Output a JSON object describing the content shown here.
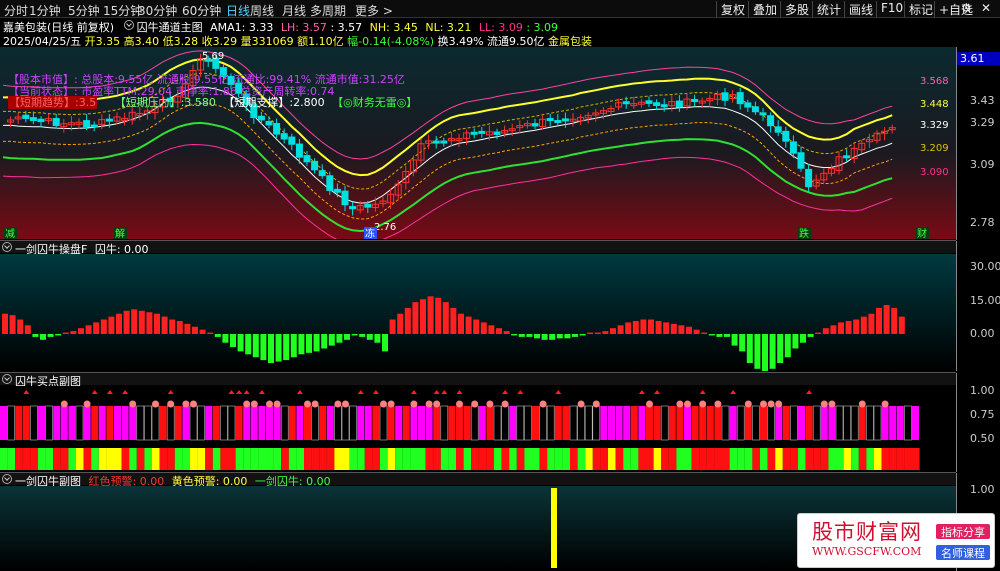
{
  "toolbar": {
    "periods": [
      "分时",
      "1分钟",
      "5分钟",
      "15分钟",
      "30分钟",
      "60分钟",
      "日线",
      "周线",
      "月线",
      "多周期",
      "更多 >"
    ],
    "active_period": "日线",
    "right_buttons": [
      "复权",
      "叠加",
      "多股",
      "统计",
      "画线",
      "F10",
      "标记",
      "+自选"
    ]
  },
  "stock": {
    "title": "嘉美包装(日线 前复权)",
    "indicator": "囚牛通道主图",
    "ama1": "AMA1: 3.33",
    "lh": "LH: 3.57",
    "h2": ": 3.57",
    "nh": "NH: 3.45",
    "nl": "NL: 3.21",
    "ll": "LL: 3.09",
    "l2": ": 3.09",
    "date": "2025/04/25/五",
    "open": "开3.35",
    "high": "高3.40",
    "low": "低3.28",
    "close": "收3.29",
    "vol": "量331069",
    "amount": "额1.10亿",
    "change": "幅-0.14(-4.08%)",
    "turnover": "换3.49%",
    "float_value": "流通9.50亿",
    "sector": "金属包装"
  },
  "overlay": {
    "line1": "【股本市值】: 总股本:9.55亿 流通股:9.55亿 流通比:99.41% 流通市值:31.25亿",
    "line2": "【当前状态】: 市盈率TTM:29.04 市净率:1.86 总资产周转率:0.74",
    "support_label": "【短期压力】:3.580",
    "press_label": "【短期支撑】:2.800",
    "finance_label": "【◎财务无雷◎】",
    "left_label": "【短期趋势】:3.5"
  },
  "main_chart": {
    "price_labels": [
      {
        "text": "5.69",
        "color": "#ffffff"
      },
      {
        "text": "2.76",
        "color": "#ffffff"
      }
    ],
    "right_values": [
      {
        "text": "3.568",
        "color": "#ff60b0"
      },
      {
        "text": "3.448",
        "color": "#ffff40"
      },
      {
        "text": "3.329",
        "color": "#ffffff"
      },
      {
        "text": "3.209",
        "color": "#e0c000"
      },
      {
        "text": "3.090",
        "color": "#ff3090"
      }
    ],
    "axis_ticks": [
      "3.61",
      "3.43",
      "3.29",
      "3.09",
      "2.78"
    ],
    "bottom_marks": [
      {
        "text": "减",
        "color": "#40ff40"
      },
      {
        "text": "解",
        "color": "#40ff40"
      },
      {
        "text": "冻",
        "color": "#ffffff"
      },
      {
        "text": "跌",
        "color": "#40ff40"
      },
      {
        "text": "财",
        "color": "#40ff40"
      }
    ]
  },
  "panel1": {
    "title": "一剑囚牛操盘F",
    "value": "囚牛: 0.00",
    "axis_ticks": [
      "30.00",
      "15.00",
      "0.00"
    ]
  },
  "panel2": {
    "title": "囚牛买点副图",
    "axis_ticks": [
      "1.00",
      "0.75",
      "0.50"
    ]
  },
  "panel3": {
    "title": "一剑囚牛副图",
    "red_warn": "红色预警: 0.00",
    "yellow_warn": "黄色预警: 0.00",
    "yijian": "一剑囚牛: 0.00",
    "axis_ticks": [
      "1.00"
    ]
  },
  "watermark": {
    "title": "股市财富网",
    "url": "WWW.GSCFW.COM",
    "tag1": "指标分享",
    "tag2": "名师课程"
  },
  "colors": {
    "up": "#ff3030",
    "down": "#00e0e0",
    "bg": "#000000"
  }
}
